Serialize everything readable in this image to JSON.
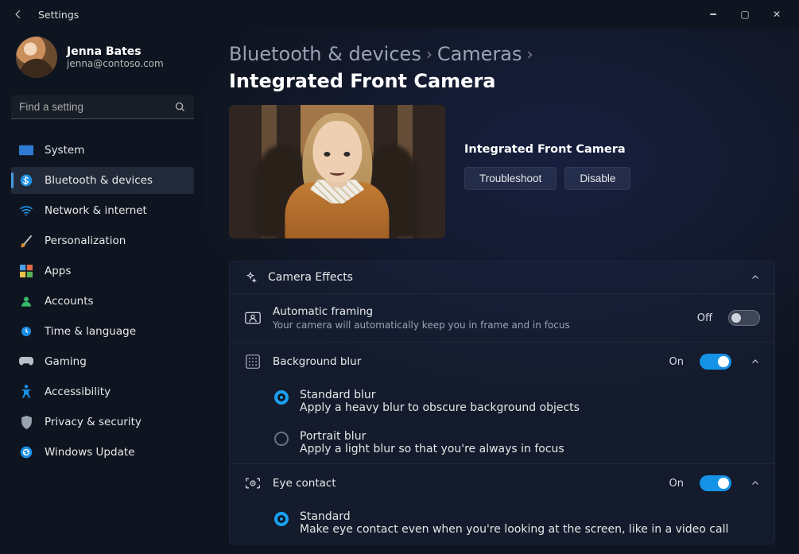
{
  "window": {
    "title": "Settings"
  },
  "user": {
    "name": "Jenna Bates",
    "email": "jenna@contoso.com"
  },
  "search": {
    "placeholder": "Find a setting"
  },
  "sidebar": {
    "items": [
      {
        "label": "System"
      },
      {
        "label": "Bluetooth & devices"
      },
      {
        "label": "Network & internet"
      },
      {
        "label": "Personalization"
      },
      {
        "label": "Apps"
      },
      {
        "label": "Accounts"
      },
      {
        "label": "Time & language"
      },
      {
        "label": "Gaming"
      },
      {
        "label": "Accessibility"
      },
      {
        "label": "Privacy & security"
      },
      {
        "label": "Windows Update"
      }
    ],
    "active_index": 1
  },
  "breadcrumb": {
    "level1": "Bluetooth & devices",
    "level2": "Cameras",
    "level3": "Integrated Front Camera"
  },
  "hero": {
    "title": "Integrated Front Camera",
    "btn_troubleshoot": "Troubleshoot",
    "btn_disable": "Disable"
  },
  "panel": {
    "title": "Camera Effects",
    "auto_framing": {
      "title": "Automatic framing",
      "desc": "Your camera will automatically keep you in frame and in focus",
      "state": "Off",
      "on": false
    },
    "bg_blur": {
      "title": "Background blur",
      "state": "On",
      "on": true,
      "options": {
        "standard": {
          "title": "Standard blur",
          "desc": "Apply a heavy blur to obscure background objects",
          "selected": true
        },
        "portrait": {
          "title": "Portrait blur",
          "desc": "Apply a light blur so that you're always in focus",
          "selected": false
        }
      }
    },
    "eye_contact": {
      "title": "Eye contact",
      "state": "On",
      "on": true,
      "options": {
        "standard": {
          "title": "Standard",
          "desc": "Make eye contact even when you're looking at the screen, like in a video call",
          "selected": true
        }
      }
    }
  },
  "colors": {
    "accent": "#1593e6"
  }
}
